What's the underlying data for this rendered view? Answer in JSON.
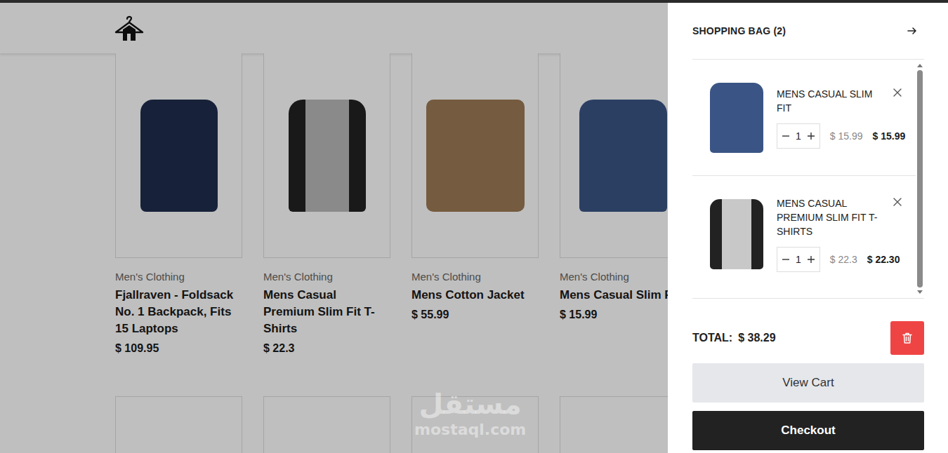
{
  "products": [
    {
      "kind": "full",
      "category": "Men's Clothing",
      "title": "Fjallraven - Foldsack No. 1 Backpack, Fits 15 Laptops",
      "price": "$ 109.95"
    },
    {
      "kind": "full",
      "category": "Men's Clothing",
      "title": "Mens Casual Premium Slim Fit T-Shirts",
      "price": "$ 22.3"
    },
    {
      "kind": "full",
      "category": "Men's Clothing",
      "title": "Mens Cotton Jacket",
      "price": "$ 55.99"
    },
    {
      "kind": "full",
      "category": "Men's Clothing",
      "title": "Mens Casual Slim F",
      "price": "$ 15.99"
    },
    {
      "kind": "image"
    },
    {
      "kind": "image"
    },
    {
      "kind": "image"
    },
    {
      "kind": "image"
    }
  ],
  "watermark": {
    "arabic": "مستقل",
    "latin": "mostaql.com"
  },
  "cart": {
    "title": "SHOPPING BAG (2)",
    "items": [
      {
        "name": "MENS CASUAL SLIM FIT",
        "quantity": "1",
        "old_price": "$ 15.99",
        "price": "$ 15.99"
      },
      {
        "name": "MENS CASUAL PREMIUM SLIM FIT T-SHIRTS",
        "quantity": "1",
        "old_price": "$ 22.3",
        "price": "$ 22.30"
      }
    ],
    "total_label": "TOTAL:",
    "total": "$ 38.29",
    "view_cart": "View Cart",
    "checkout": "Checkout"
  }
}
